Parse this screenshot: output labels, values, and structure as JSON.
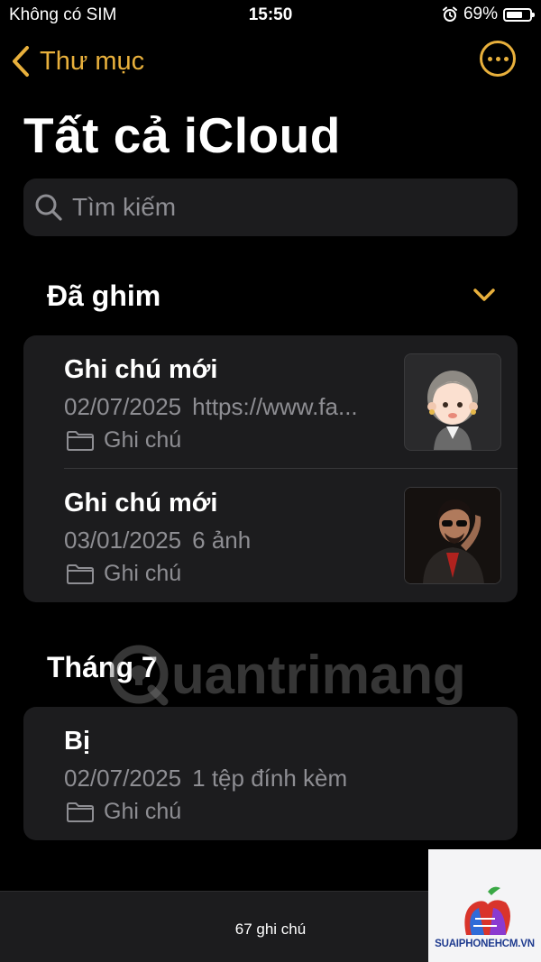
{
  "status_bar": {
    "carrier": "Không có SIM",
    "time": "15:50",
    "battery_percent_label": "69%",
    "battery_level": 0.69
  },
  "nav": {
    "back_label": "Thư mục",
    "accent_color": "#e8b03c"
  },
  "page_title": "Tất cả iCloud",
  "search": {
    "placeholder": "Tìm kiếm"
  },
  "sections": {
    "pinned": {
      "title": "Đã ghim",
      "notes": [
        {
          "title": "Ghi chú mới",
          "date": "02/07/2025",
          "preview": "https://www.fa...",
          "folder": "Ghi chú",
          "thumbnail": "cartoon-avatar"
        },
        {
          "title": "Ghi chú mới",
          "date": "03/01/2025",
          "preview": "6 ảnh",
          "folder": "Ghi chú",
          "thumbnail": "man-sunglasses-photo"
        }
      ]
    },
    "july": {
      "title": "Tháng 7",
      "notes": [
        {
          "title": "Bị",
          "date": "02/07/2025",
          "preview": "1 tệp đính kèm",
          "folder": "Ghi chú"
        }
      ]
    }
  },
  "watermark": "uantrimang",
  "toolbar": {
    "count_label": "67 ghi chú"
  },
  "logo_badge": {
    "text": "SUAIPHONEHCM.VN"
  }
}
